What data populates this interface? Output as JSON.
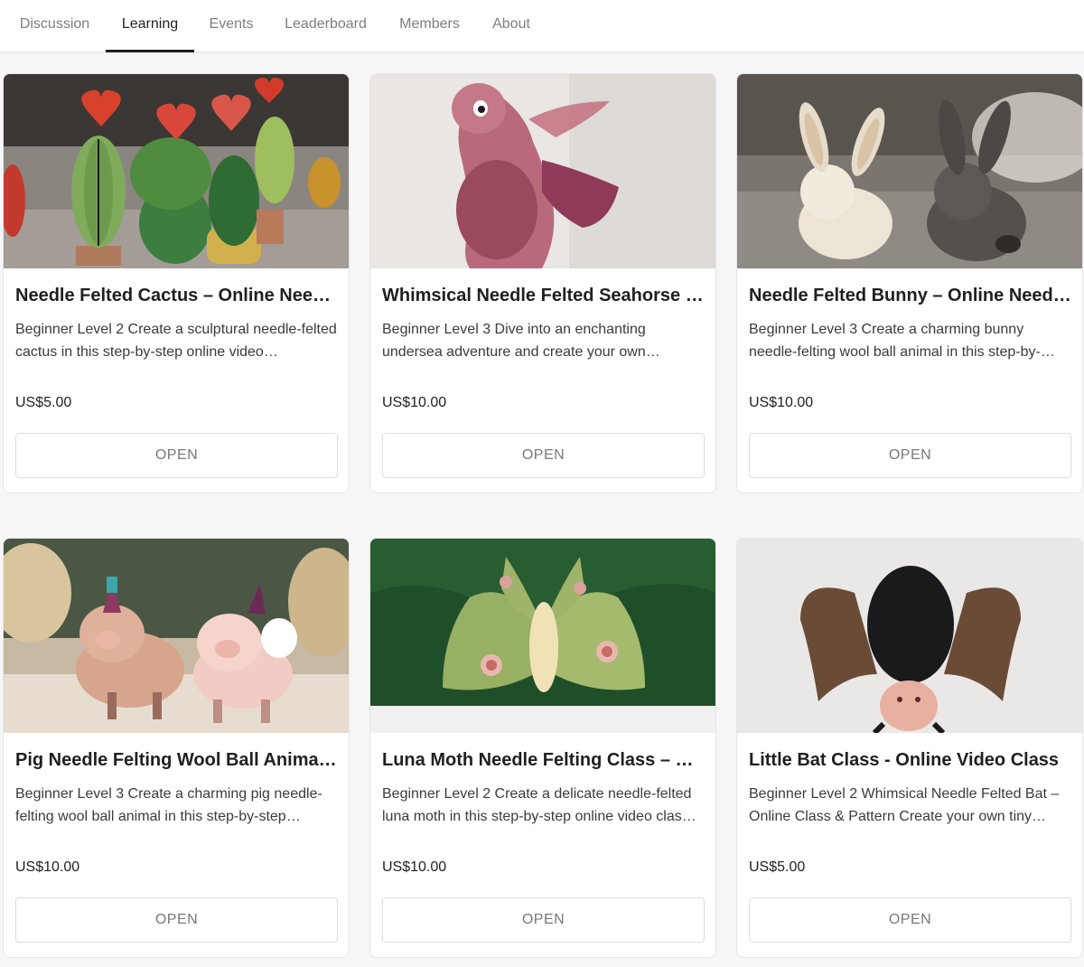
{
  "nav": {
    "tabs": [
      {
        "label": "Discussion"
      },
      {
        "label": "Learning"
      },
      {
        "label": "Events"
      },
      {
        "label": "Leaderboard"
      },
      {
        "label": "Members"
      },
      {
        "label": "About"
      }
    ],
    "active_tab": "Learning"
  },
  "courses": [
    {
      "title": "Needle Felted Cactus – Online Needl…",
      "description": "Beginner Level 2 Create a sculptural needle-felted cactus in this step-by-step online video…",
      "price": "US$5.00",
      "button": "OPEN",
      "image": "cactus-photo"
    },
    {
      "title": "Whimsical Needle Felted Seahorse –…",
      "description": "Beginner Level 3 Dive into an enchanting undersea adventure and create your own…",
      "price": "US$10.00",
      "button": "OPEN",
      "image": "seahorse-photo"
    },
    {
      "title": "Needle Felted Bunny – Online Needl…",
      "description": "Beginner Level 3 Create a charming bunny needle-felting wool ball animal in this step-by-…",
      "price": "US$10.00",
      "button": "OPEN",
      "image": "bunny-photo"
    },
    {
      "title": "Pig Needle Felting Wool Ball Animal …",
      "description": "Beginner Level 3 Create a charming pig needle-felting wool ball animal in this step-by-step…",
      "price": "US$10.00",
      "button": "OPEN",
      "image": "pig-photo"
    },
    {
      "title": "Luna Moth Needle Felting Class – W…",
      "description": "Beginner Level 2 Create a delicate needle-felted luna moth in this step-by-step online video clas…",
      "price": "US$10.00",
      "button": "OPEN",
      "image": "luna-moth-photo"
    },
    {
      "title": "Little Bat Class - Online Video Class",
      "description": "Beginner Level 2 Whimsical Needle Felted Bat – Online Class & Pattern Create your own tiny…",
      "price": "US$5.00",
      "button": "OPEN",
      "image": "bat-photo"
    }
  ]
}
